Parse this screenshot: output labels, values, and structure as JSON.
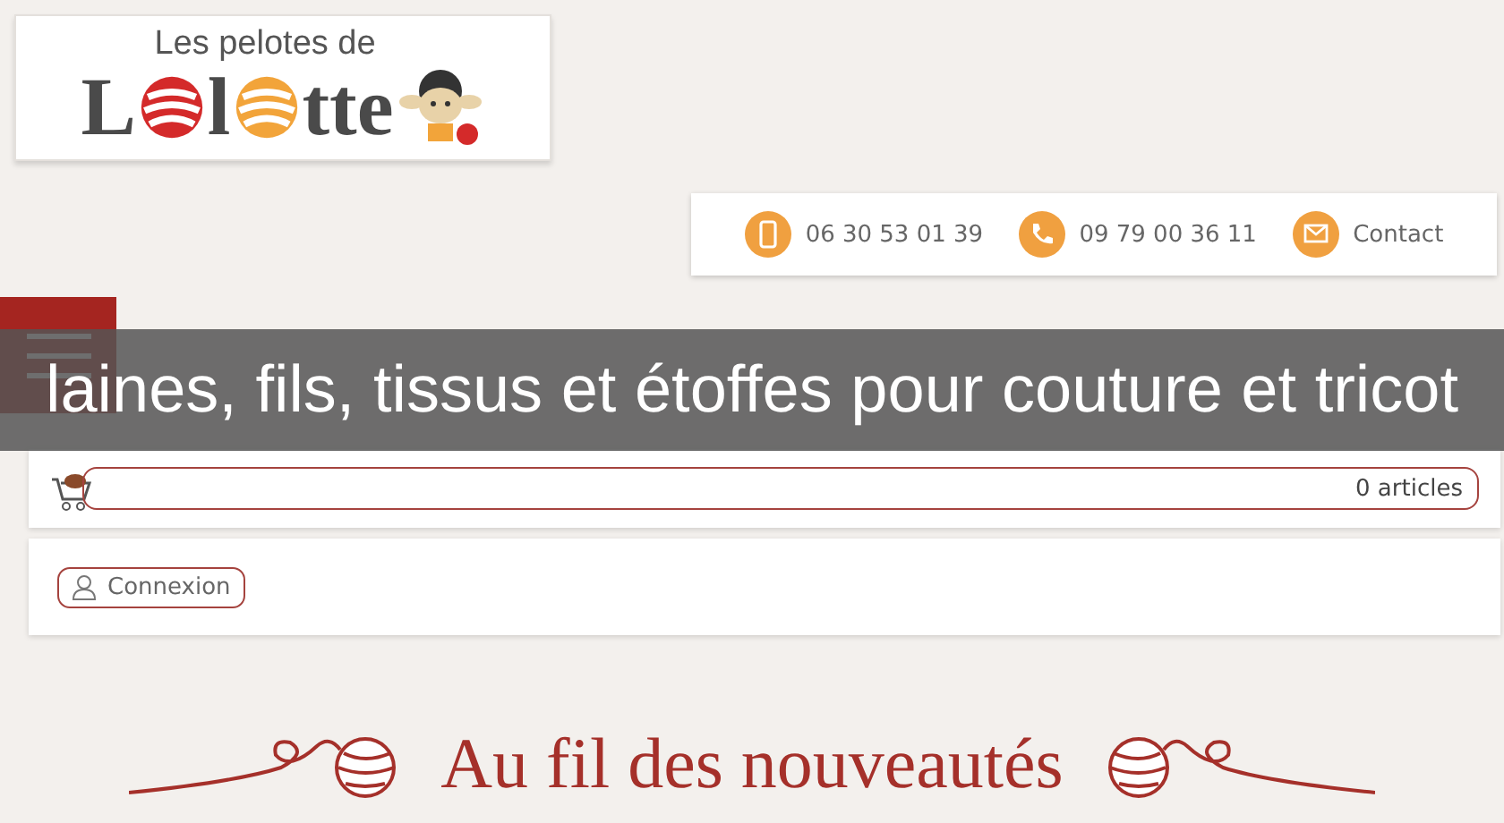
{
  "logo": {
    "tagline": "Les pelotes de",
    "word_parts": [
      "L",
      "l",
      "tte"
    ]
  },
  "contact_bar": [
    {
      "kind": "mobile",
      "label": "06 30 53 01 39"
    },
    {
      "kind": "phone",
      "label": "09 79 00 36 11"
    },
    {
      "kind": "mail",
      "label": "Contact"
    }
  ],
  "banner": {
    "text": "laines, fils, tissus et étoffes pour couture et tricot"
  },
  "cart": {
    "count": "0 articles"
  },
  "account": {
    "label": "Connexion"
  },
  "section": {
    "title": "Au fil des nouveautés"
  }
}
